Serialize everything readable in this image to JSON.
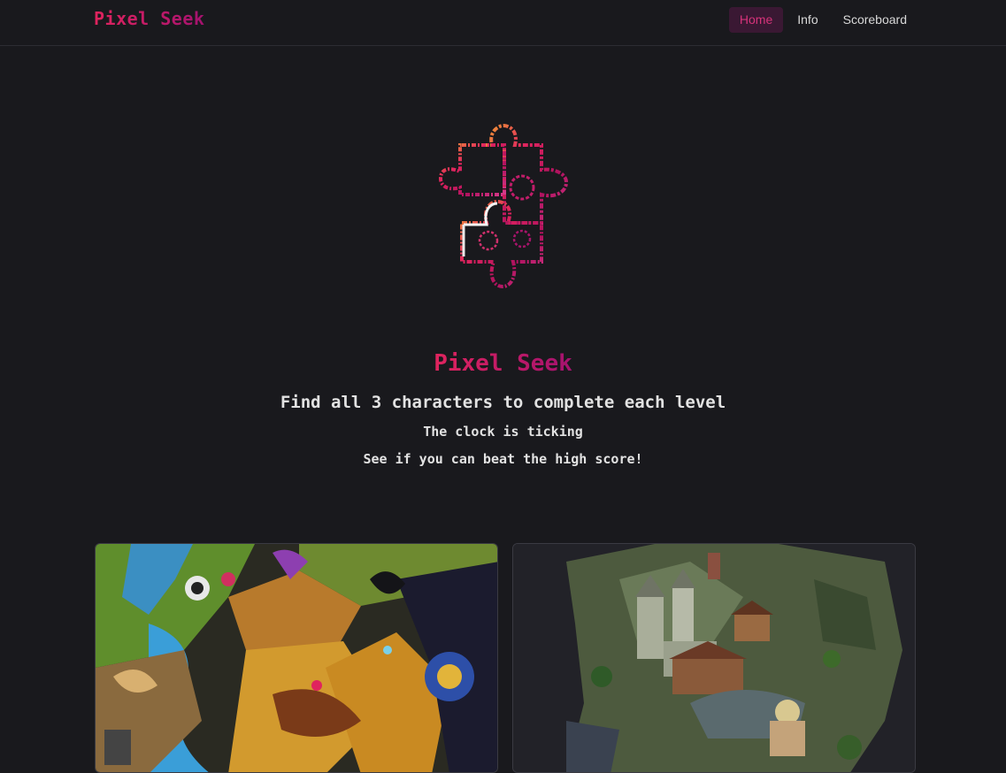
{
  "navbar": {
    "brand": "Pixel Seek",
    "links": [
      {
        "label": "Home",
        "active": true
      },
      {
        "label": "Info",
        "active": false
      },
      {
        "label": "Scoreboard",
        "active": false
      }
    ]
  },
  "hero": {
    "logo_icon": "puzzle-piece-icon",
    "title": "Pixel Seek",
    "subtitle": "Find all 3 characters to complete each level",
    "line2": "The clock is ticking",
    "line3": "See if you can beat the high score!"
  },
  "levels": [
    {
      "image": "fantasy-world-level-image"
    },
    {
      "image": "medieval-town-level-image"
    }
  ],
  "colors": {
    "background": "#19191d",
    "accent_start": "#e0245e",
    "accent_end": "#a4126f",
    "active_nav_bg": "#3a1833"
  }
}
